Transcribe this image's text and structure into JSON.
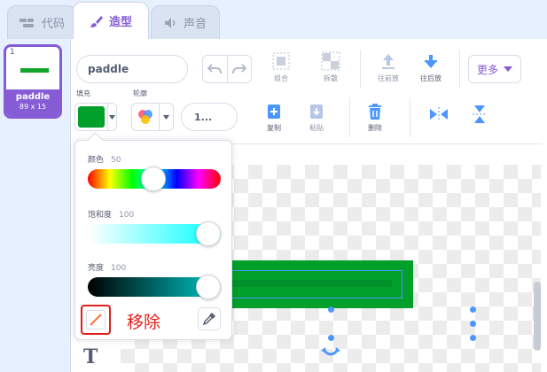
{
  "tabs": [
    {
      "label": "代码",
      "icon": "code-icon",
      "active": false
    },
    {
      "label": "造型",
      "icon": "brush-icon",
      "active": true
    },
    {
      "label": "声音",
      "icon": "speaker-icon",
      "active": false
    }
  ],
  "sprite": {
    "number": "1",
    "name": "paddle",
    "size": "89 x 15"
  },
  "costume_name": "paddle",
  "toolbar": {
    "group": "组合",
    "ungroup": "拆散",
    "forward": "往前放",
    "backward": "往后放",
    "more": "更多",
    "copy": "复制",
    "paste": "粘贴",
    "delete": "删除"
  },
  "fill_label": "填充",
  "outline_label": "轮廓",
  "outline_width": "1...",
  "color_picker": {
    "hue_label": "颜色",
    "hue_value": "50",
    "saturation_label": "饱和度",
    "saturation_value": "100",
    "brightness_label": "亮度",
    "brightness_value": "100",
    "remove_note": "移除"
  },
  "colors": {
    "accent": "#855cd6",
    "fill": "#00a02a",
    "highlight": "#e0201a",
    "selection": "#4c97ff"
  }
}
